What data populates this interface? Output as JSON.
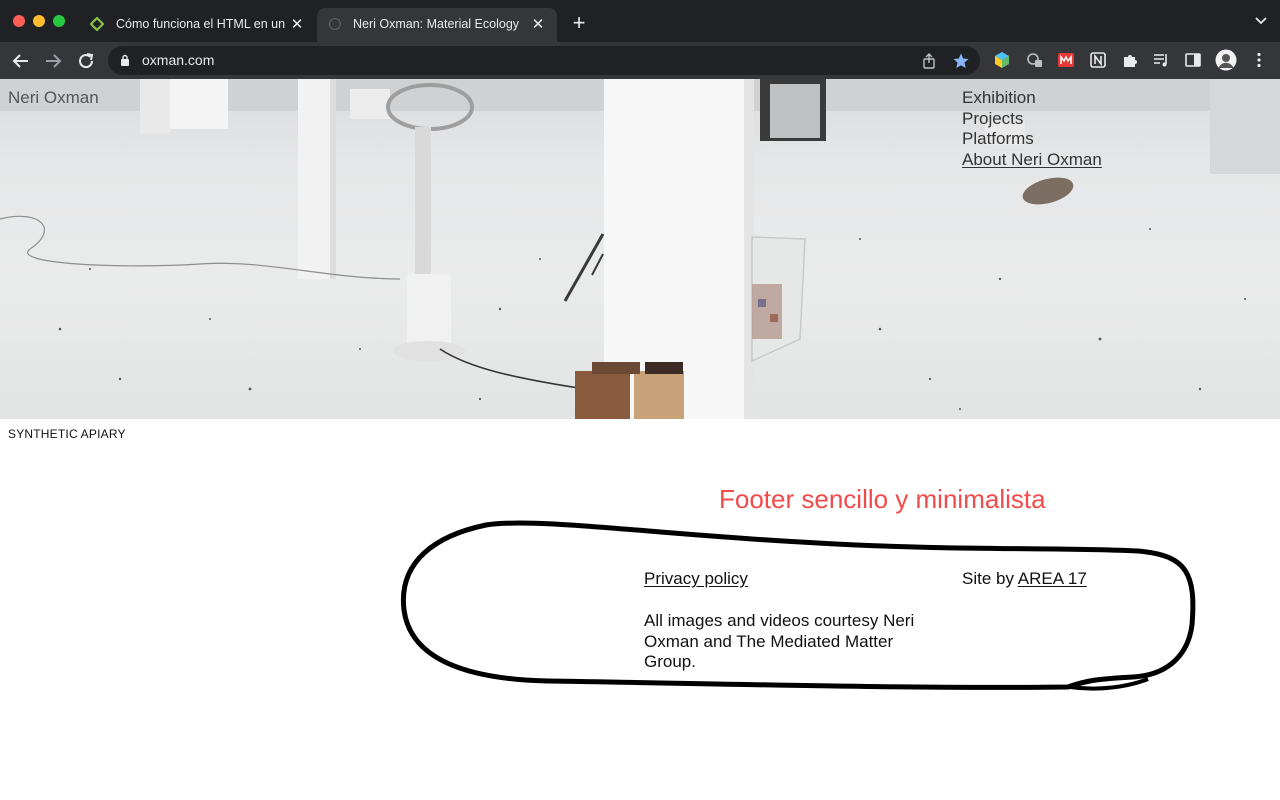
{
  "browser": {
    "tabs": [
      {
        "title": "Cómo funciona el HTML en un",
        "active": false
      },
      {
        "title": "Neri Oxman: Material Ecology",
        "active": true
      }
    ],
    "url": "oxman.com"
  },
  "site": {
    "title": "Neri Oxman",
    "nav": [
      "Exhibition",
      "Projects",
      "Platforms",
      "About Neri Oxman"
    ],
    "caption": "SYNTHETIC APIARY"
  },
  "annotation": {
    "text": "Footer sencillo y minimalista",
    "color": "#f24b4b"
  },
  "footer": {
    "privacy": "Privacy policy",
    "site_by_prefix": "Site by",
    "site_by_link": "AREA 17",
    "credits": "All images and videos courtesy Neri Oxman and The Mediated Matter Group."
  }
}
